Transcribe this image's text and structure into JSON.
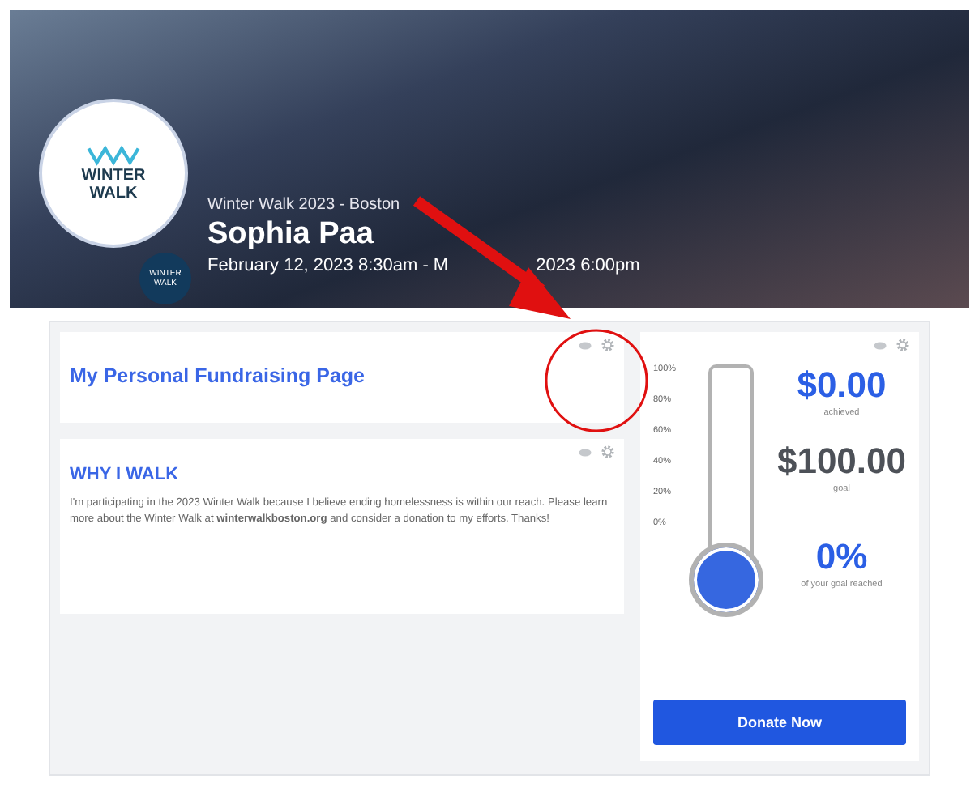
{
  "header": {
    "logo_text": "WINTER WALK",
    "badge_text": "WINTER WALK",
    "event": "Winter Walk 2023 - Boston",
    "name": "Sophia Paa",
    "date_start": "February 12, 2023 8:30am - M",
    "date_end": "2023 6:00pm"
  },
  "title_card": {
    "title": "My Personal Fundraising Page"
  },
  "story_card": {
    "heading": "WHY I WALK",
    "text": "I'm participating in the 2023 Winter Walk because I believe ending homelessness is within our reach. Please learn more about the Winter Walk at **winterwalkboston.org** and consider a donation to my efforts.  Thanks!"
  },
  "progress": {
    "ticks": [
      "100%",
      "80%",
      "60%",
      "40%",
      "20%",
      "0%"
    ],
    "level": 0,
    "achieved": "$0.00",
    "achieved_label": "achieved",
    "goal": "$100.00",
    "goal_label": "goal",
    "percent": "0%",
    "percent_label": "of your goal reached",
    "button": "Donate Now"
  }
}
